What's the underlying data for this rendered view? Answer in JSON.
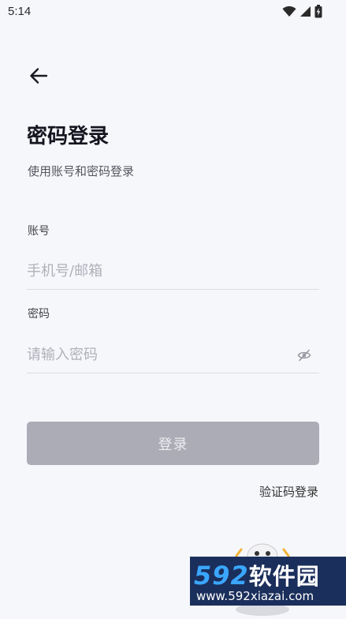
{
  "status_bar": {
    "time": "5:14",
    "icons": [
      "wifi-icon",
      "cellular-signal-icon",
      "battery-charging-icon"
    ]
  },
  "header": {
    "back_icon": "arrow-left-icon",
    "title": "密码登录",
    "subtitle": "使用账号和密码登录"
  },
  "form": {
    "account": {
      "label": "账号",
      "value": "",
      "placeholder": "手机号/邮箱"
    },
    "password": {
      "label": "密码",
      "value": "",
      "placeholder": "请输入密码",
      "visibility_icon": "eye-off-icon"
    },
    "submit_label": "登录",
    "alt_login_label": "验证码登录"
  },
  "colors": {
    "background": "#f6f7fb",
    "button_disabled": "#abacb6",
    "divider": "#dcdce2",
    "watermark_bg": "#1b2f5c",
    "watermark_accent": "#3aa6ff"
  },
  "watermark": {
    "brand_number": "592",
    "brand_name": "软件园",
    "url": "www.592xiazai.com"
  }
}
